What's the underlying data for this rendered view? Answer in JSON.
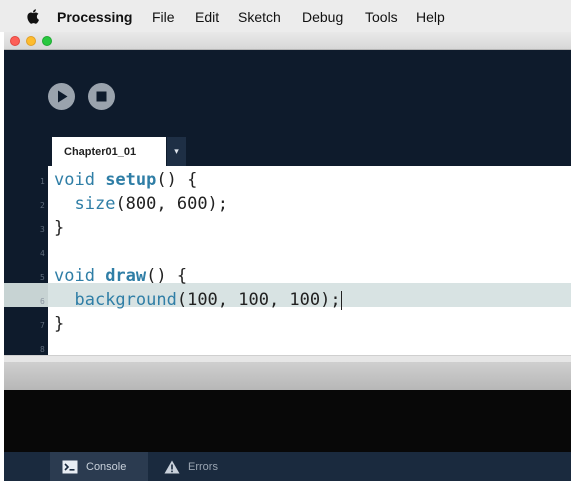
{
  "menubar": {
    "app_name": "Processing",
    "items": [
      "File",
      "Edit",
      "Sketch",
      "Debug",
      "Tools",
      "Help"
    ]
  },
  "toolbar": {
    "run_icon": "play-icon",
    "stop_icon": "stop-icon"
  },
  "tabs": {
    "active": "Chapter01_01",
    "menu_glyph": "▾"
  },
  "editor": {
    "line_numbers": [
      "1",
      "2",
      "3",
      "4",
      "5",
      "6",
      "7",
      "8"
    ],
    "highlighted_line": 6,
    "lines": [
      [
        {
          "t": "void ",
          "c": "kw"
        },
        {
          "t": "setup",
          "c": "fn"
        },
        {
          "t": "() {",
          "c": ""
        }
      ],
      [
        {
          "t": "  ",
          "c": ""
        },
        {
          "t": "size",
          "c": "bi"
        },
        {
          "t": "(800, 600);",
          "c": ""
        }
      ],
      [
        {
          "t": "}",
          "c": ""
        }
      ],
      [],
      [
        {
          "t": "void ",
          "c": "kw"
        },
        {
          "t": "draw",
          "c": "fn"
        },
        {
          "t": "() {",
          "c": ""
        }
      ],
      [
        {
          "t": "  ",
          "c": ""
        },
        {
          "t": "background",
          "c": "bi"
        },
        {
          "t": "(100, 100, 100);",
          "c": ""
        }
      ],
      [
        {
          "t": "}",
          "c": ""
        }
      ],
      []
    ]
  },
  "footer": {
    "console_label": "Console",
    "errors_label": "Errors"
  },
  "colors": {
    "window_bg": "#0e1b2c",
    "keyword": "#2f7ea6",
    "highlight_row": "#d8e3e3"
  }
}
